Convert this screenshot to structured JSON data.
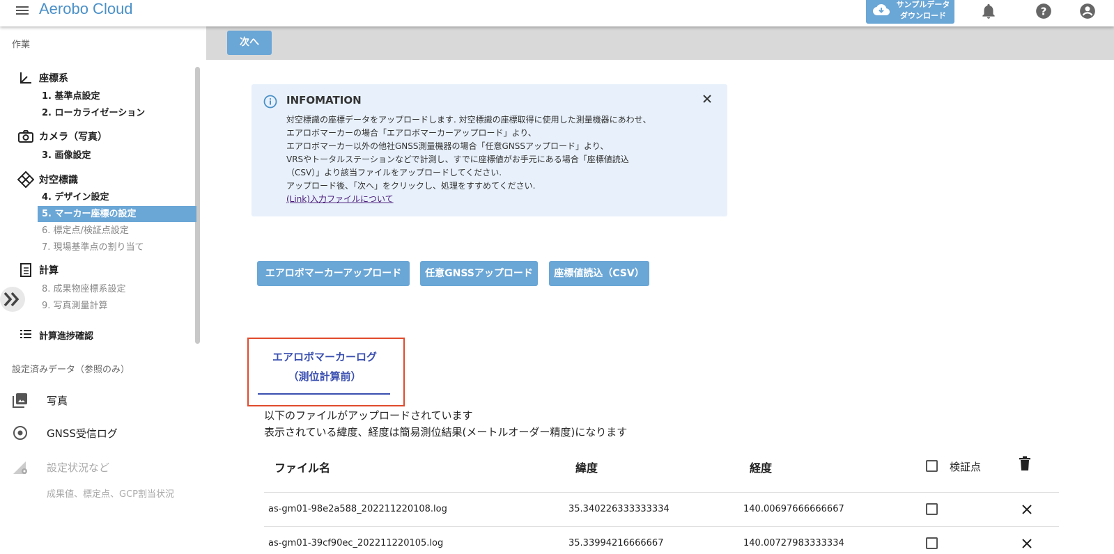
{
  "header": {
    "app_title": "Aerobo Cloud",
    "download_button": "サンプルデータ\nダウンロード",
    "icons": [
      "menu-icon",
      "cloud-download-icon",
      "bell-icon",
      "help-icon",
      "account-icon"
    ]
  },
  "sidebar": {
    "section_work": "作業",
    "groups": [
      {
        "label": "座標系",
        "icon": "axis-icon",
        "items": [
          {
            "label": "1. 基準点設定"
          },
          {
            "label": "2. ローカライゼーション"
          }
        ]
      },
      {
        "label": "カメラ（写真）",
        "icon": "camera-icon",
        "items": [
          {
            "label": "3. 画像設定"
          }
        ]
      },
      {
        "label": "対空標識",
        "icon": "marker-diamond-icon",
        "items": [
          {
            "label": "4. デザイン設定"
          },
          {
            "label": "5. マーカー座標の設定"
          },
          {
            "label": "6. 標定点/検証点設定"
          },
          {
            "label": "7. 現場基準点の割り当て"
          }
        ]
      },
      {
        "label": "計算",
        "icon": "calc-list-icon",
        "items": [
          {
            "label": "8. 成果物座標系設定"
          },
          {
            "label": "9. 写真測量計算"
          }
        ]
      },
      {
        "label": "計算進捗確認",
        "icon": "progress-list-icon",
        "items": []
      }
    ],
    "active_item": "5. マーカー座標の設定",
    "section_ref": "設定済みデータ（参照のみ）",
    "ref_items": [
      {
        "label": "写真",
        "icon": "photo-icon"
      },
      {
        "label": "GNSS受信ログ",
        "icon": "gnss-icon"
      },
      {
        "label": "設定状況など",
        "sub": "成果値、標定点、GCP割当状況",
        "icon": "settings-status-icon"
      }
    ]
  },
  "main": {
    "next_button": "次へ",
    "info": {
      "title": "INFOMATION",
      "lines": [
        "対空標識の座標データをアップロードします. 対空標識の座標取得に使用した測量機器にあわせ、",
        "エアロボマーカーの場合「エアロボマーカーアップロード」より、",
        "エアロボマーカー以外の他社GNSS測量機器の場合「任意GNSSアップロード」より、",
        "VRSやトータルステーションなどで計測し、すでに座標値がお手元にある場合「座標値読込",
        "（CSV）」より該当ファイルをアップロードしてください.",
        "アップロード後、「次へ」をクリックし、処理をすすめてください."
      ],
      "link": "(Link)入力ファイルについて"
    },
    "upload_buttons": [
      "エアロボマーカーアップロード",
      "任意GNSSアップロード",
      "座標値読込（CSV）"
    ],
    "tab": {
      "line1": "エアロボマーカーログ",
      "line2": "（測位計算前）"
    },
    "desc1": "以下のファイルがアップロードされています",
    "desc2": "表示されている緯度、経度は簡易測位結果(メートルオーダー精度)になります",
    "table": {
      "headers": {
        "file": "ファイル名",
        "lat": "緯度",
        "lon": "経度",
        "check": "検証点"
      },
      "rows": [
        {
          "file": "as-gm01-98e2a588_202211220108.log",
          "lat": "35.340226333333334",
          "lon": "140.00697666666667",
          "checked": false
        },
        {
          "file": "as-gm01-39cf90ec_202211220105.log",
          "lat": "35.33994216666667",
          "lon": "140.00727983333334",
          "checked": false
        }
      ]
    }
  }
}
